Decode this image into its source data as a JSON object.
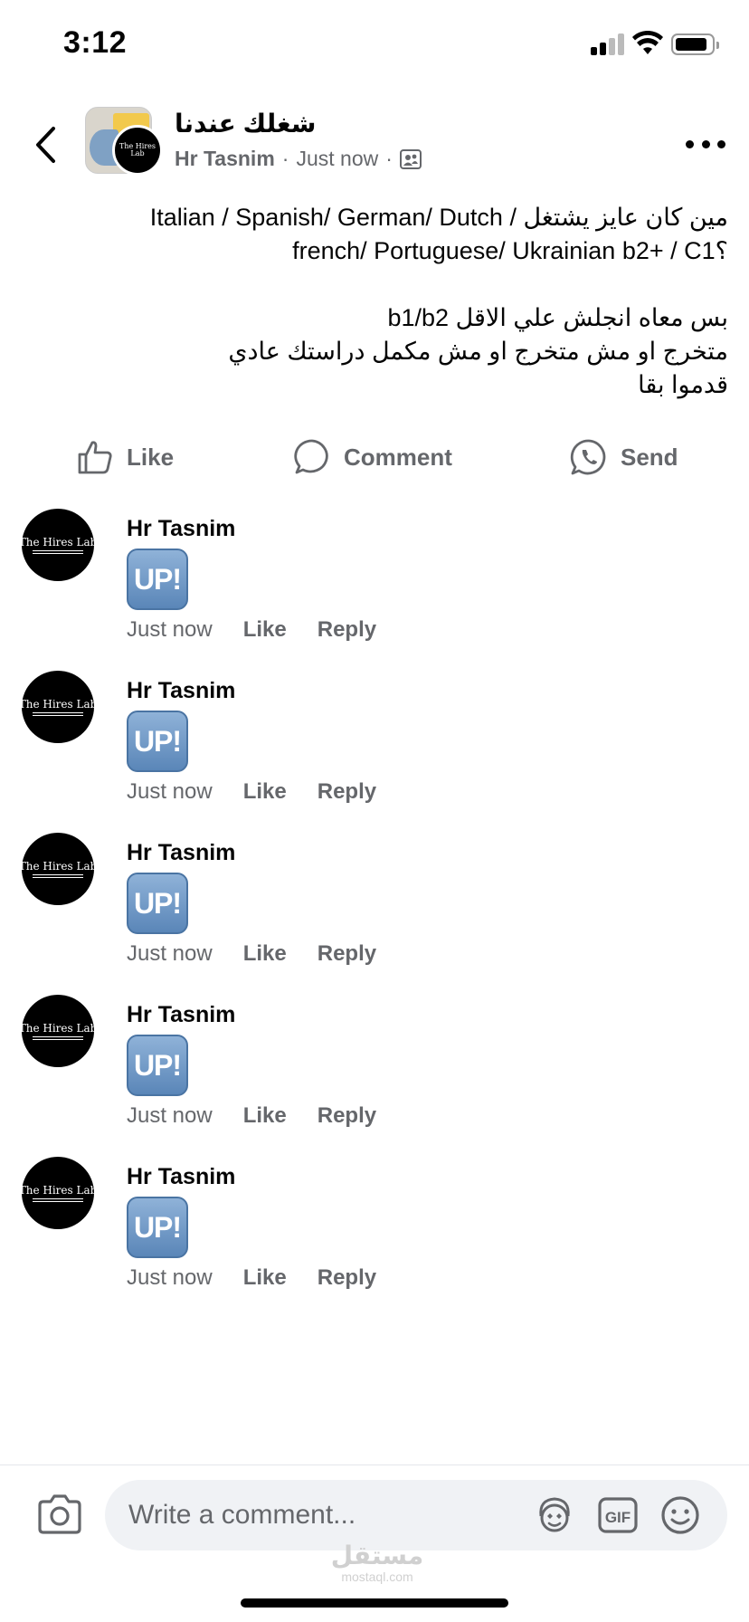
{
  "status_bar": {
    "time": "3:12"
  },
  "header": {
    "group_name": "شغلك عندنا",
    "author": "Hr Tasnim",
    "timestamp": "Just now",
    "separator": "·",
    "group_avatar_icon": "megaphone-sign-icon",
    "author_avatar_text": "The Hires Lab"
  },
  "post": {
    "lines": [
      "مين كان عايز يشتغل / Italian / Spanish/ German/ Dutch",
      "؟french/ Portuguese/ Ukrainian b2+ / C1",
      "بس معاه انجلش علي الاقل b1/b2",
      "متخرج او مش متخرج او مش مكمل دراستك عادي",
      "قدموا بقا"
    ]
  },
  "actions": {
    "like": "Like",
    "comment": "Comment",
    "send": "Send"
  },
  "comments": [
    {
      "author": "Hr Tasnim",
      "sticker": "UP!",
      "time": "Just now",
      "like": "Like",
      "reply": "Reply"
    },
    {
      "author": "Hr Tasnim",
      "sticker": "UP!",
      "time": "Just now",
      "like": "Like",
      "reply": "Reply"
    },
    {
      "author": "Hr Tasnim",
      "sticker": "UP!",
      "time": "Just now",
      "like": "Like",
      "reply": "Reply"
    },
    {
      "author": "Hr Tasnim",
      "sticker": "UP!",
      "time": "Just now",
      "like": "Like",
      "reply": "Reply"
    },
    {
      "author": "Hr Tasnim",
      "sticker": "UP!",
      "time": "Just now",
      "like": "Like",
      "reply": "Reply"
    }
  ],
  "avatar": {
    "logo_text": "The Hires Lab"
  },
  "composer": {
    "placeholder": "Write a comment...",
    "gif_label": "GIF"
  },
  "watermark": {
    "arabic": "مستقل",
    "latin": "mostaql.com"
  },
  "colors": {
    "secondary_text": "#65676b",
    "sticker_blue": "#5a86b8",
    "input_bg": "#f0f2f5"
  }
}
